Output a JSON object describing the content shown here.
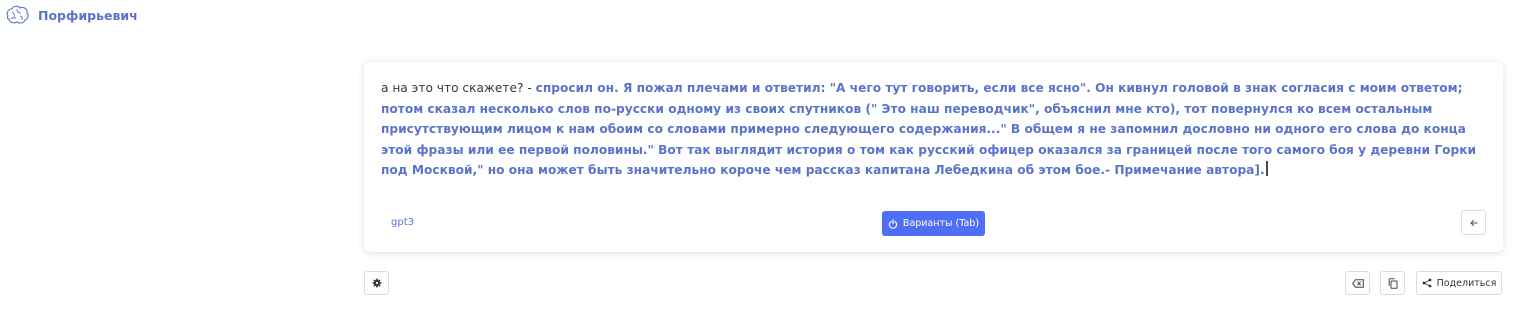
{
  "header": {
    "app_name": "Порфирьевич",
    "logo_icon": "brain-icon"
  },
  "editor": {
    "user_text": "а на это что скажете? - ",
    "generated_text": "спросил он.  Я пожал плечами и ответил: \"А чего тут говорить, если все ясно\". Он кивнул головой в знак согласия с моим ответом; потом сказал несколько слов по-русски одному из своих спутников (\" Это наш переводчик\", объяснил мне кто), тот повернулся ко всем остальным присутствующим лицом к нам обоим со словами примерно следующего содержания...\" В общем я не запомнил дословно ни одного его слова до конца этой фразы или ее первой половины.\" Вот так выглядит история о том как русский офицер оказался за границей после того самого боя у деревни Горки под Москвой,\" но она может быть значительно короче чем рассказ капитана Лебедкина об этом бое.- Примечание автора]."
  },
  "footer": {
    "model": "gpt3",
    "variants_label": "Варианты (Tab)",
    "share_label": "Поделиться"
  },
  "colors": {
    "accent": "#4f6ef7",
    "brand_text": "#5b74c9"
  }
}
